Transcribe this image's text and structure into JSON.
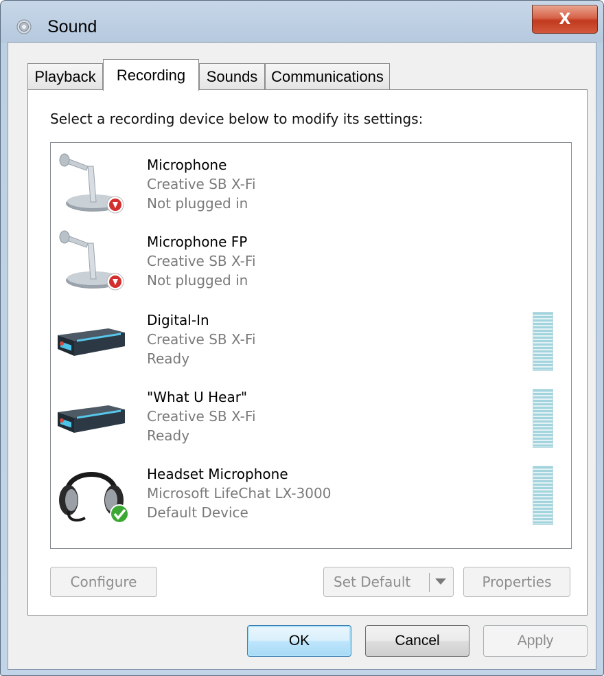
{
  "window": {
    "title": "Sound",
    "title_icon": "speaker-icon",
    "close_label": "X"
  },
  "tabs": [
    {
      "label": "Playback",
      "active": false
    },
    {
      "label": "Recording",
      "active": true
    },
    {
      "label": "Sounds",
      "active": false
    },
    {
      "label": "Communications",
      "active": false
    }
  ],
  "panel": {
    "prompt": "Select a recording device below to modify its settings:"
  },
  "devices": [
    {
      "name": "Microphone",
      "driver": "Creative SB X-Fi",
      "status": "Not plugged in",
      "icon": "microphone-icon",
      "badge": "unplugged-badge-icon"
    },
    {
      "name": "Microphone FP",
      "driver": "Creative SB X-Fi",
      "status": "Not plugged in",
      "icon": "microphone-icon",
      "badge": "unplugged-badge-icon"
    },
    {
      "name": "Digital-In",
      "driver": "Creative SB X-Fi",
      "status": "Ready",
      "icon": "sound-card-device-icon",
      "level": 0
    },
    {
      "name": "\"What U Hear\"",
      "driver": "Creative SB X-Fi",
      "status": "Ready",
      "icon": "sound-card-device-icon",
      "level": 0
    },
    {
      "name": "Headset Microphone",
      "driver": "Microsoft LifeChat LX-3000",
      "status": "Default Device",
      "icon": "headset-icon",
      "badge": "default-check-icon",
      "level": 0
    }
  ],
  "buttons": {
    "configure": "Configure",
    "set_default": "Set Default",
    "properties": "Properties",
    "ok": "OK",
    "cancel": "Cancel",
    "apply": "Apply"
  },
  "colors": {
    "close_button": "#c13a1e",
    "level_meter": "#a3d3dd",
    "unplugged_badge": "#d32f2f",
    "default_badge": "#3aa833"
  }
}
